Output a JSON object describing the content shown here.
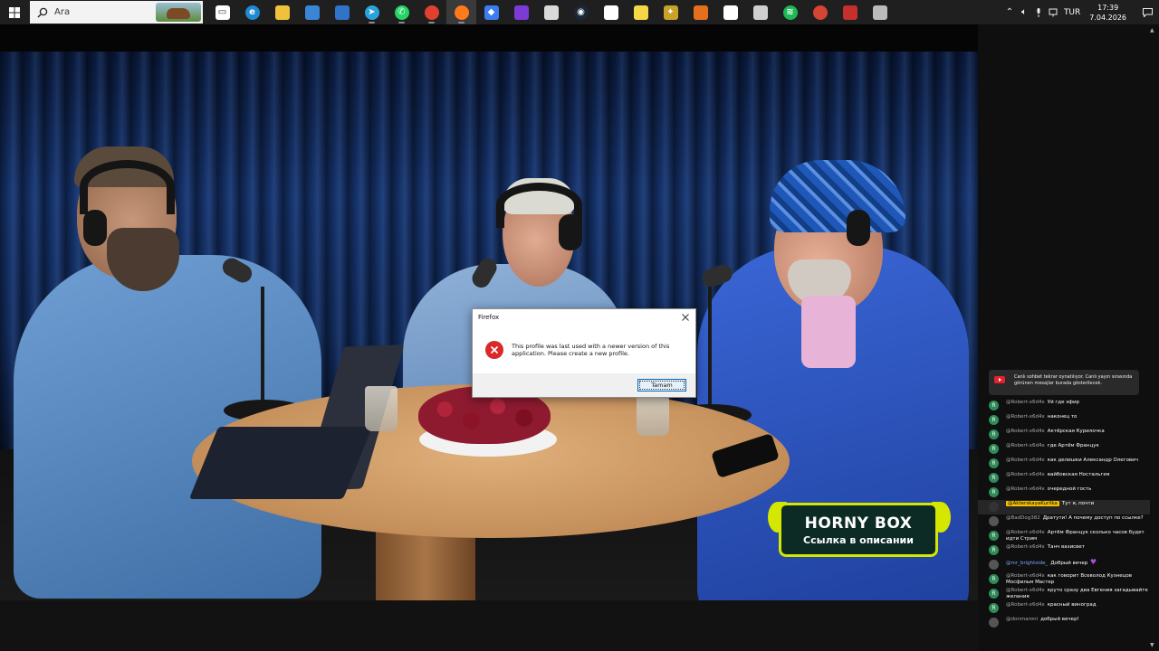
{
  "taskbar": {
    "search_placeholder": "Ara",
    "apps": [
      {
        "icon": "task-view-icon",
        "color": "#ffffff",
        "glyph": "▭"
      },
      {
        "icon": "edge-icon",
        "color": "#1f8ad2",
        "glyph": "e"
      },
      {
        "icon": "file-explorer-icon",
        "color": "#f0c23a",
        "glyph": ""
      },
      {
        "icon": "store-icon",
        "color": "#3a86d6",
        "glyph": ""
      },
      {
        "icon": "mail-icon",
        "color": "#2f74c9",
        "glyph": ""
      },
      {
        "icon": "telegram-icon",
        "color": "#2aa3dc",
        "glyph": "➤"
      },
      {
        "icon": "whatsapp-icon",
        "color": "#25d366",
        "glyph": "✆"
      },
      {
        "icon": "chrome-icon",
        "color": "#e0412f",
        "glyph": ""
      },
      {
        "icon": "firefox-icon",
        "color": "#ff7a1a",
        "glyph": ""
      },
      {
        "icon": "app-drop-icon",
        "color": "#3c7df0",
        "glyph": "◆"
      },
      {
        "icon": "app-purple-icon",
        "color": "#7c3bd4",
        "glyph": ""
      },
      {
        "icon": "app-tool-icon",
        "color": "#d9d9d9",
        "glyph": ""
      },
      {
        "icon": "steam-icon",
        "color": "#1b2838",
        "glyph": "◉"
      },
      {
        "icon": "notepad-icon",
        "color": "#ffffff",
        "glyph": ""
      },
      {
        "icon": "sticky-notes-icon",
        "color": "#f5d845",
        "glyph": ""
      },
      {
        "icon": "app-game-icon",
        "color": "#c9a227",
        "glyph": "✦"
      },
      {
        "icon": "app-shield-icon",
        "color": "#e3701c",
        "glyph": ""
      },
      {
        "icon": "document-icon",
        "color": "#ffffff",
        "glyph": ""
      },
      {
        "icon": "app-globe-icon",
        "color": "#cfcfcf",
        "glyph": ""
      },
      {
        "icon": "spotify-icon",
        "color": "#1db954",
        "glyph": "≋"
      },
      {
        "icon": "chrome-profile-icon",
        "color": "#d54435",
        "glyph": ""
      },
      {
        "icon": "app-red-icon",
        "color": "#c4302b",
        "glyph": ""
      },
      {
        "icon": "app-gray-icon",
        "color": "#bbbbbb",
        "glyph": ""
      }
    ],
    "active_app_index": 8,
    "tray": {
      "language": "TUR",
      "time": "17:39",
      "date": "7.04.2026"
    }
  },
  "dialog": {
    "title": "Firefox",
    "message": "This profile was last used with a newer version of this application. Please create a new profile.",
    "ok_label": "Tamam"
  },
  "promo": {
    "brand": "HORNY BOX",
    "subtitle": "Ссылка в описании"
  },
  "chat": {
    "banner": "Canlı sohbet tekrar oynatılıyor. Canlı yayın sırasında görünen mesajlar burada gösterilecek.",
    "messages": [
      {
        "author": "@Robert-x6d4x",
        "text": "Уй где эфир",
        "avatar": "R",
        "style": "normal"
      },
      {
        "author": "@Robert-x6d4x",
        "text": "наконец то",
        "avatar": "R",
        "style": "normal"
      },
      {
        "author": "@Robert-x6d4x",
        "text": "Актёрская Курилочка",
        "avatar": "R",
        "style": "normal"
      },
      {
        "author": "@Robert-x6d4x",
        "text": "где Артём Францук",
        "avatar": "R",
        "style": "normal"
      },
      {
        "author": "@Robert-x6d4x",
        "text": "как делишки Александр Олегович",
        "avatar": "R",
        "style": "normal"
      },
      {
        "author": "@Robert-x6d4x",
        "text": "вайбовская Ностальгия",
        "avatar": "R",
        "style": "normal"
      },
      {
        "author": "@Robert-x6d4x",
        "text": "очередной гость",
        "avatar": "R",
        "style": "normal"
      },
      {
        "author": "@AkterskayaKurilka",
        "text": "Тут я, почти",
        "avatar": "",
        "style": "owner"
      },
      {
        "author": "@BadDog382",
        "text": "Дратути! А почему доступ по ссылке?",
        "avatar": "",
        "style": "gray"
      },
      {
        "author": "@Robert-x6d4x",
        "text": "Артём Францук сколько часов будет идти Стрим",
        "avatar": "R",
        "style": "normal"
      },
      {
        "author": "@Robert-x6d4x",
        "text": "Танч вазисвет",
        "avatar": "R",
        "style": "normal"
      },
      {
        "author": "@mr_brightside_",
        "text": "Добрый вечер",
        "avatar": "",
        "style": "member"
      },
      {
        "author": "@Robert-x6d4x",
        "text": "как говорит Всеволод Кузнецов Мосфильм Мастер",
        "avatar": "R",
        "style": "normal"
      },
      {
        "author": "@Robert-x6d4x",
        "text": "круто сразу два Евгения загадывайте желания",
        "avatar": "R",
        "style": "normal"
      },
      {
        "author": "@Robert-x6d4x",
        "text": "красный виноград",
        "avatar": "R",
        "style": "normal"
      },
      {
        "author": "@donmaroni",
        "text": "добрый вечер!",
        "avatar": "",
        "style": "gray"
      }
    ]
  }
}
